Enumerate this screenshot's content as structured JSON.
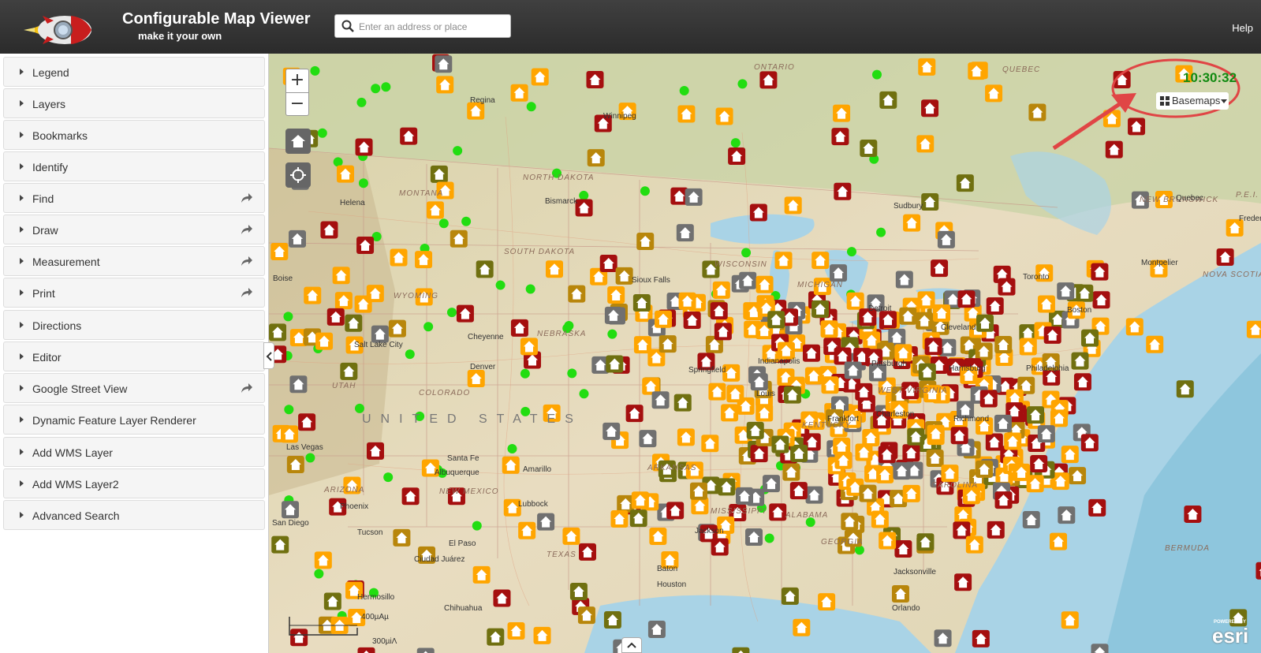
{
  "header": {
    "title": "Configurable Map Viewer",
    "subtitle": "make it your own",
    "help_label": "Help"
  },
  "search": {
    "placeholder": "Enter an address or place"
  },
  "sidebar": {
    "items": [
      {
        "label": "Legend",
        "has_share_icon": false
      },
      {
        "label": "Layers",
        "has_share_icon": false
      },
      {
        "label": "Bookmarks",
        "has_share_icon": false
      },
      {
        "label": "Identify",
        "has_share_icon": false
      },
      {
        "label": "Find",
        "has_share_icon": true
      },
      {
        "label": "Draw",
        "has_share_icon": true
      },
      {
        "label": "Measurement",
        "has_share_icon": true
      },
      {
        "label": "Print",
        "has_share_icon": true
      },
      {
        "label": "Directions",
        "has_share_icon": false
      },
      {
        "label": "Editor",
        "has_share_icon": false
      },
      {
        "label": "Google Street View",
        "has_share_icon": true
      },
      {
        "label": "Dynamic Feature Layer Renderer",
        "has_share_icon": false
      },
      {
        "label": "Add WMS Layer",
        "has_share_icon": false
      },
      {
        "label": "Add WMS Layer2",
        "has_share_icon": false
      },
      {
        "label": "Advanced Search",
        "has_share_icon": false
      }
    ]
  },
  "map": {
    "zoom_in": "+",
    "zoom_out": "−",
    "clock_time": "10:30:32",
    "basemaps_label": "Basemaps",
    "scale_top": "400µΑµ",
    "scale_bottom": "300µiΛ",
    "esri_powered": "POWERED BY",
    "esri_name": "esri",
    "country_label": "UNITED STATES",
    "places": [
      "Regina",
      "Winnipeg",
      "Helena",
      "Bismarck",
      "Sudbury",
      "Quebec",
      "Fredericton",
      "Salt Lake City",
      "Cheyenne",
      "Denver",
      "Springfield",
      "Indianapolis",
      "Pittsburgh",
      "Harrisburg",
      "Philadelphia",
      "Boston",
      "Richmond",
      "Frankfort",
      "Charleston",
      "Santa Fe",
      "Albuquerque",
      "Amarillo",
      "Lubbock",
      "Las Vegas",
      "Phoenix",
      "Tucson",
      "Ciudad Juárez",
      "El Paso",
      "Hermosillo",
      "Chihuahua",
      "Houston",
      "Baton",
      "Jacksonville",
      "Orlando",
      "Montpelier",
      "Toronto",
      "Detroit",
      "Cleveland",
      "Louis",
      "Sioux Falls",
      "Boise",
      "San Diego",
      "Jackson"
    ],
    "regions": [
      "ONTARIO",
      "QUEBEC",
      "NORTH DAKOTA",
      "MONTANA",
      "SOUTH DAKOTA",
      "WYOMING",
      "NEBRASKA",
      "WISCONSIN",
      "MICHIGAN",
      "UTAH",
      "COLORADO",
      "ARIZONA",
      "NEW MEXICO",
      "TEXAS",
      "ARKANSAS",
      "MISSISSIPPI",
      "ALABAMA",
      "GEORGIA",
      "KENTUCKY",
      "WEST VIRGINIA",
      "CAROLINA",
      "NEW BRUNSWICK",
      "NOVA SCOTIA",
      "P.E.I.",
      "BERMUDA"
    ]
  },
  "colors": {
    "header_bg": "#333333",
    "marker_orange": "#ffa500",
    "marker_red": "#a50f0f",
    "marker_olive": "#707010",
    "marker_gray": "#707070",
    "marker_brown": "#b8860b",
    "green_point": "#22dd11",
    "clock_green": "#118a11",
    "annotation_red": "#e04545"
  }
}
